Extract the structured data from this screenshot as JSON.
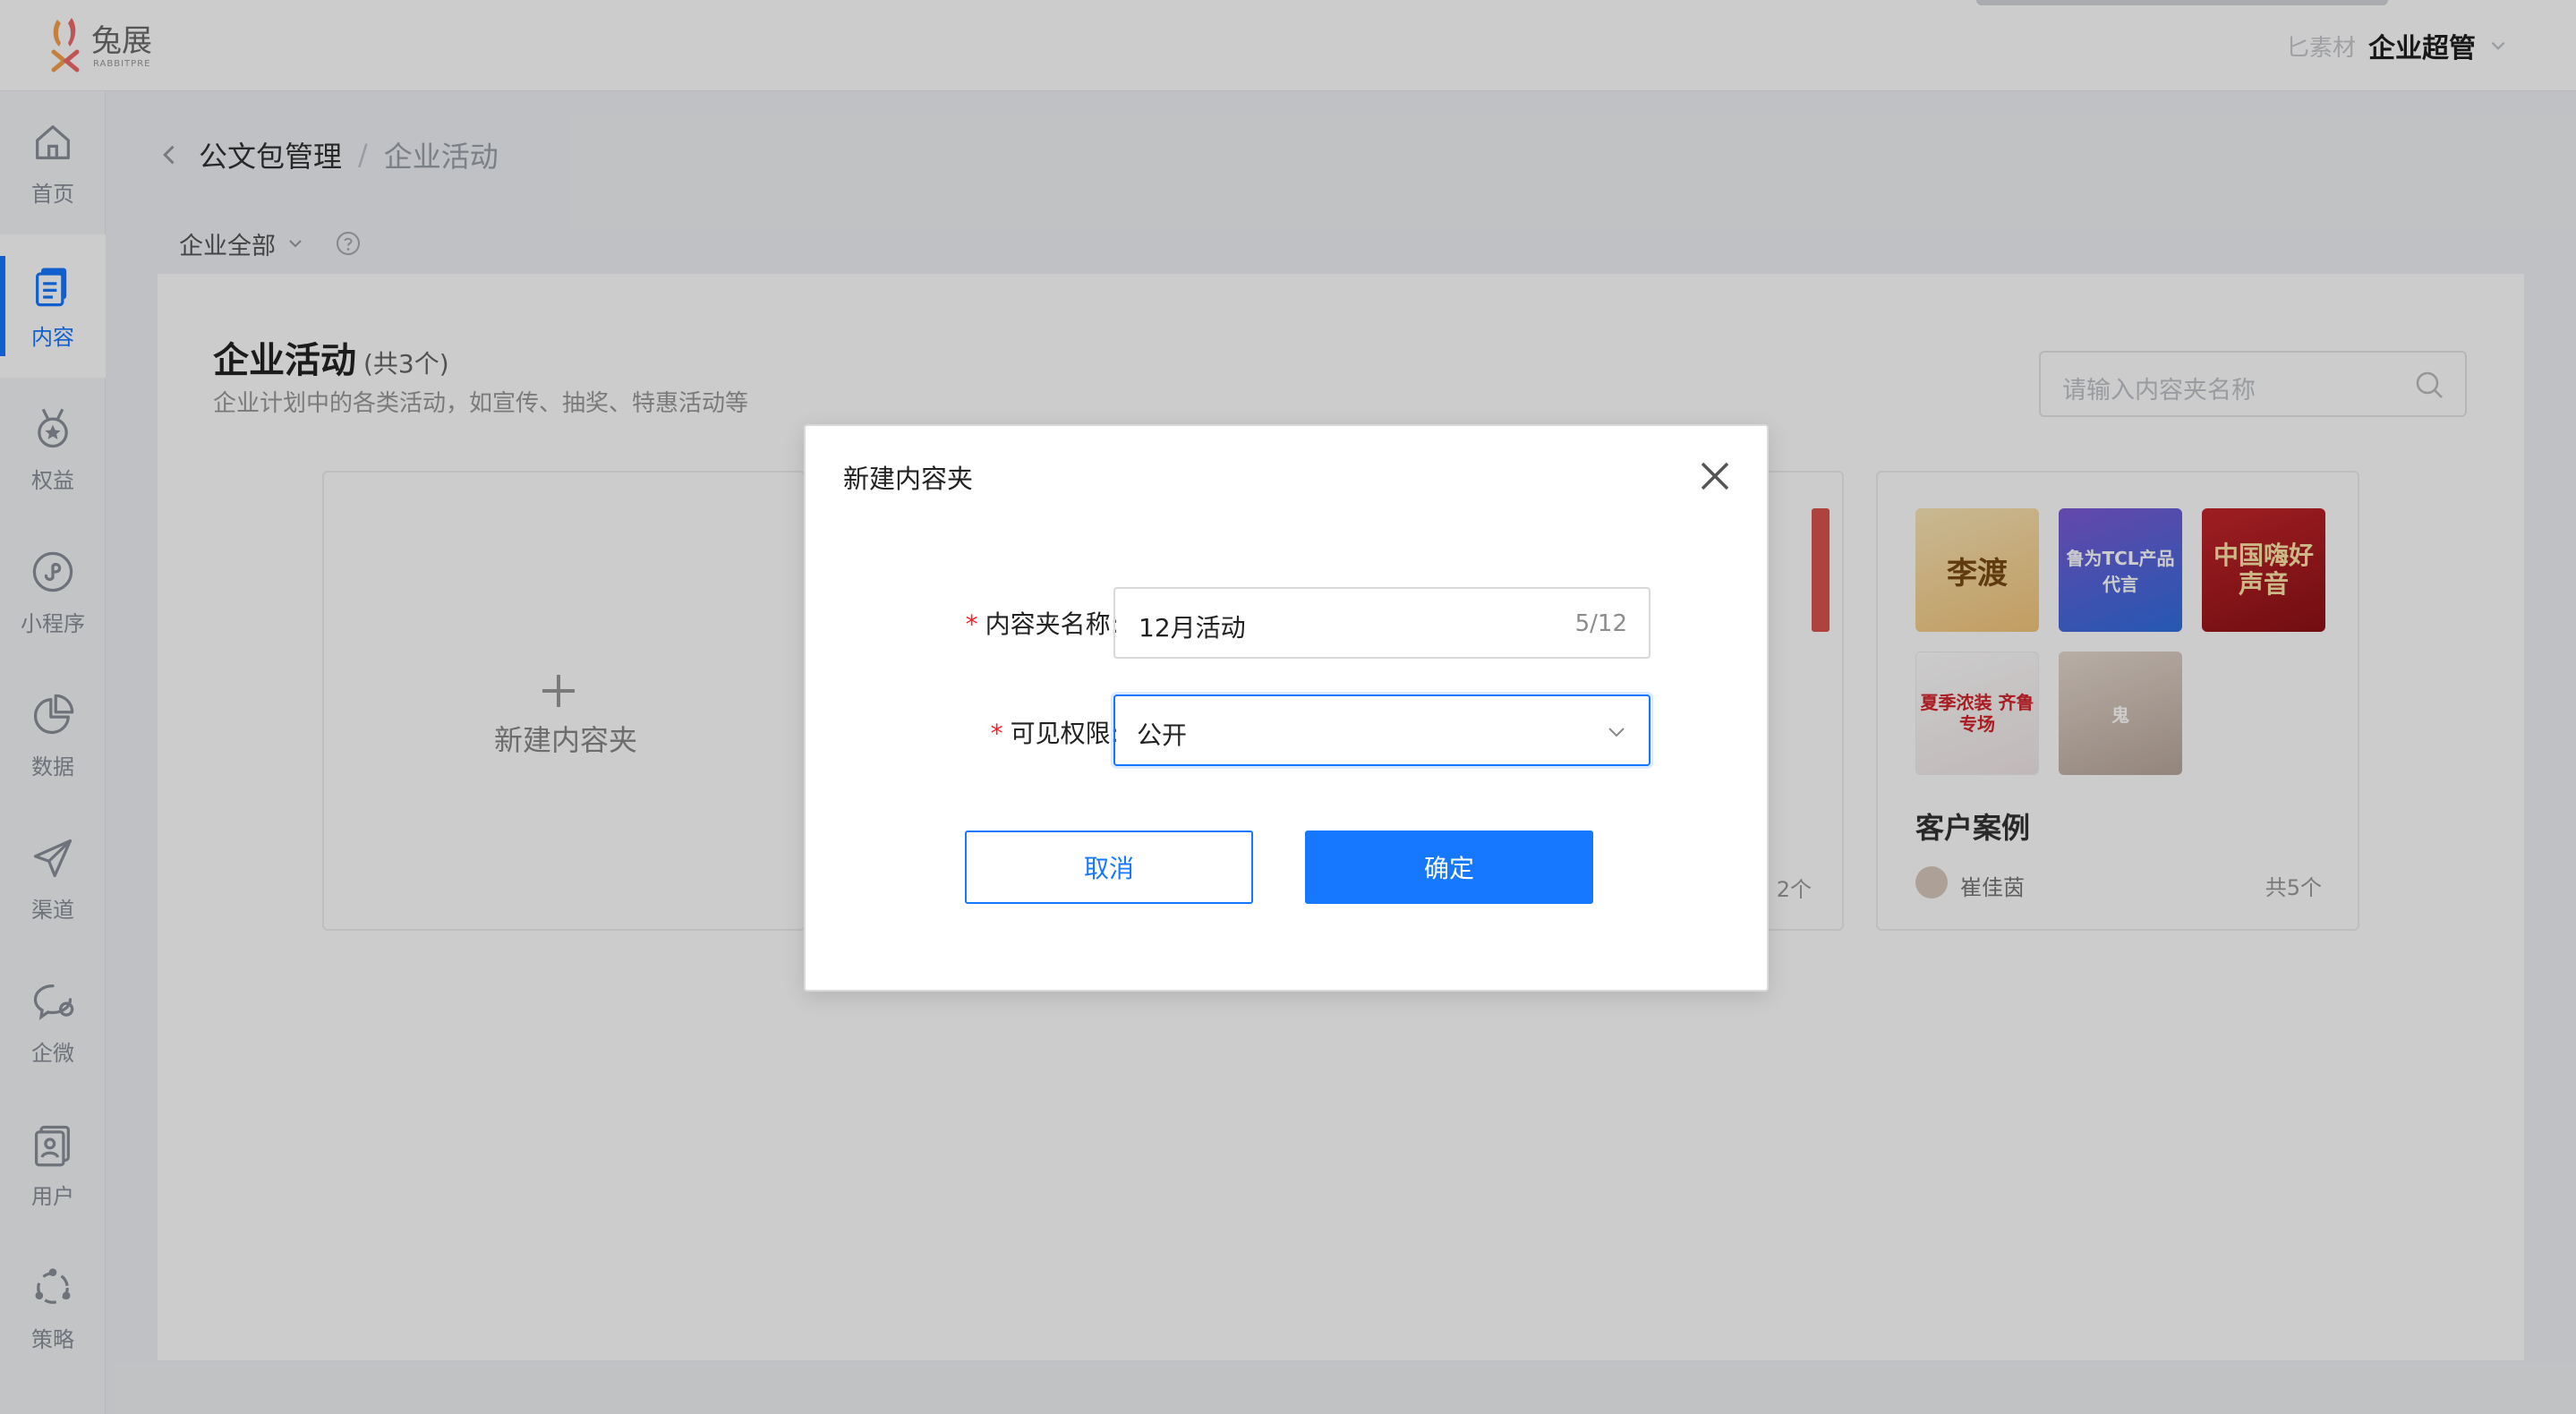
{
  "brand": {
    "name": "兔展",
    "sub": "RABBITPRE"
  },
  "topbar": {
    "tag": "匕素材",
    "user": "企业超管"
  },
  "sidebar": {
    "items": [
      {
        "label": "首页",
        "icon": "home-icon"
      },
      {
        "label": "内容",
        "icon": "content-icon",
        "active": true
      },
      {
        "label": "权益",
        "icon": "medal-icon"
      },
      {
        "label": "小程序",
        "icon": "mini-program-icon"
      },
      {
        "label": "数据",
        "icon": "pie-chart-icon"
      },
      {
        "label": "渠道",
        "icon": "paper-plane-icon"
      },
      {
        "label": "企微",
        "icon": "chat-icon"
      },
      {
        "label": "用户",
        "icon": "user-card-icon"
      },
      {
        "label": "策略",
        "icon": "strategy-icon"
      }
    ]
  },
  "breadcrumb": {
    "parent": "公文包管理",
    "separator": "/",
    "current": "企业活动"
  },
  "filter": {
    "label": "企业全部"
  },
  "panel": {
    "title": "企业活动",
    "count": "(共3个)",
    "description": "企业计划中的各类活动，如宣传、抽奖、特惠活动等",
    "search_placeholder": "请输入内容夹名称"
  },
  "cards": {
    "new_label": "新建内容夹",
    "middle_count": "2个",
    "case": {
      "title": "客户案例",
      "author": "崔佳茵",
      "count": "共5个",
      "thumbs": [
        "李渡",
        "鲁为TCL产品代言",
        "中国嗨好声音",
        "夏季浓装 齐鲁专场",
        "鬼"
      ]
    }
  },
  "dialog": {
    "title": "新建内容夹",
    "name_label": "内容夹名称:",
    "name_value": "12月活动",
    "name_counter": "5/12",
    "perm_label": "可见权限:",
    "perm_value": "公开",
    "cancel_label": "取消",
    "ok_label": "确定"
  },
  "colors": {
    "primary": "#1677ff",
    "required": "#f5222d"
  }
}
